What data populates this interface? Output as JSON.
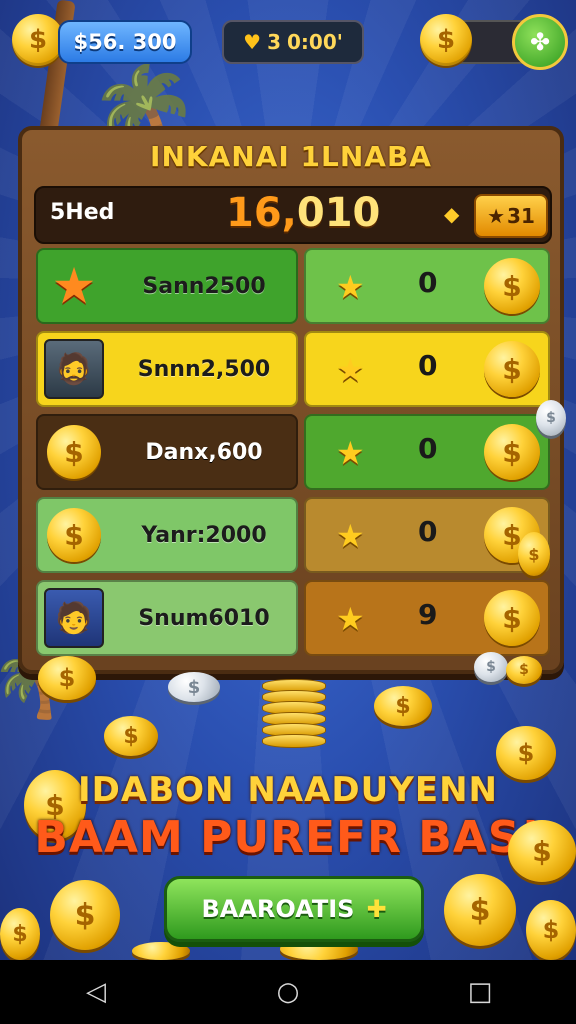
{
  "hud": {
    "money": "$56. 300",
    "lives": "3",
    "timer": "0:00'",
    "coin_icon": "$",
    "clover_icon": "clover-icon"
  },
  "board": {
    "title": "INKANAI 1LNABA",
    "score_label": "5Hed",
    "score_main": "16,",
    "score_tail": "010",
    "star_badge": "31"
  },
  "rows": [
    {
      "name": "Sann2500",
      "count": "0",
      "left_color": "#3fa32c",
      "right_color": "#6ec24a",
      "icon": "star-icon"
    },
    {
      "name": "Snnn2,500",
      "count": "0",
      "left_color": "#f7d51c",
      "right_color": "#f7d51c",
      "icon": "player-avatar"
    },
    {
      "name": "Danx,600",
      "count": "0",
      "left_color": "#4a2e14",
      "right_color": "#4fa82e",
      "icon": "coin-icon"
    },
    {
      "name": "Yanr:2000",
      "count": "0",
      "left_color": "#7fc768",
      "right_color": "#b98a2e",
      "icon": "coin-icon"
    },
    {
      "name": "Snum6010",
      "count": "9",
      "left_color": "#8ac86f",
      "right_color": "#b8741a",
      "icon": "player-avatar"
    }
  ],
  "promo": {
    "line1": "IDABON NAADUYENN",
    "line2": "BAAM PUREFR BAS!"
  },
  "cta": {
    "label": "BAAROATIS"
  }
}
